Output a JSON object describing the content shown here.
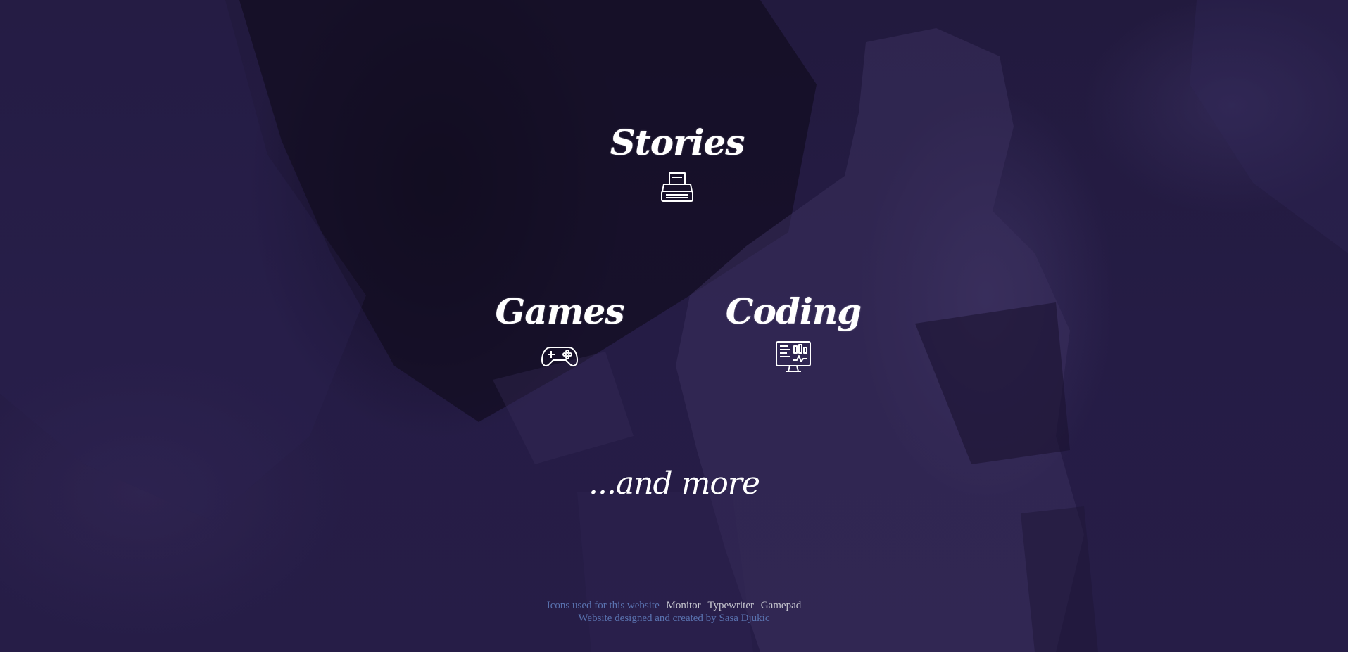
{
  "menu": {
    "stories": {
      "label": "Stories",
      "icon": "typewriter-icon"
    },
    "games": {
      "label": "Games",
      "icon": "gamepad-icon"
    },
    "coding": {
      "label": "Coding",
      "icon": "monitor-icon"
    }
  },
  "more_text": "...and more",
  "footer": {
    "icons_label": "Icons used for this website",
    "icon_credits": [
      "Monitor",
      "Typewriter",
      "Gamepad"
    ],
    "designed_by": "Website designed and created by",
    "author": "Sasa Djukic"
  },
  "colors": {
    "background": "#241a42",
    "text": "#ffffff",
    "footer_link": "#5a73b0",
    "footer_credit": "#c6c6cf"
  }
}
